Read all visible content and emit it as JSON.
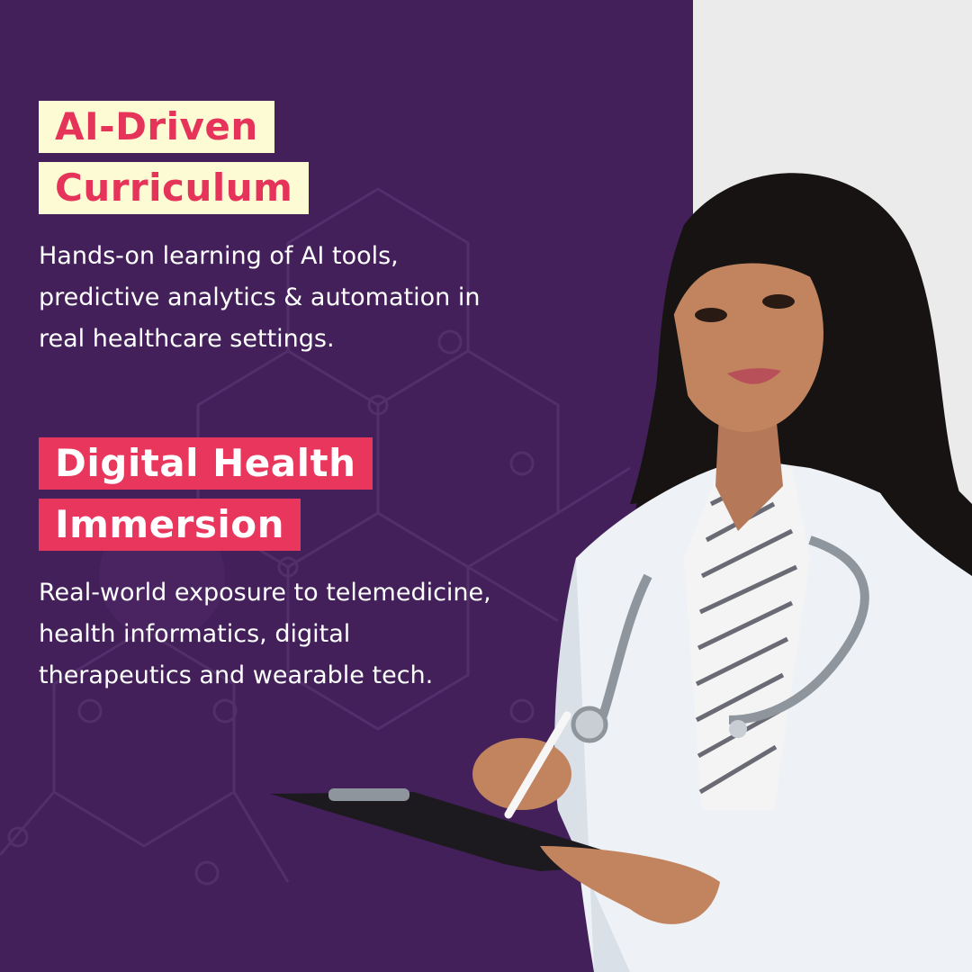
{
  "section1": {
    "heading_line1": "AI-Driven",
    "heading_line2": "Curriculum",
    "body_line1": "Hands-on learning of AI tools,",
    "body_line2": "predictive analytics & automation in",
    "body_line3": "real healthcare settings."
  },
  "section2": {
    "heading_line1": "Digital Health",
    "heading_line2": "Immersion",
    "body_line1": "Real-world exposure to telemedicine,",
    "body_line2": "health informatics, digital",
    "body_line3": "therapeutics and wearable tech."
  },
  "colors": {
    "background": "#43205a",
    "panel": "#ebebec",
    "accent_pink": "#e8365d",
    "highlight_cream": "#fdfbd3"
  }
}
